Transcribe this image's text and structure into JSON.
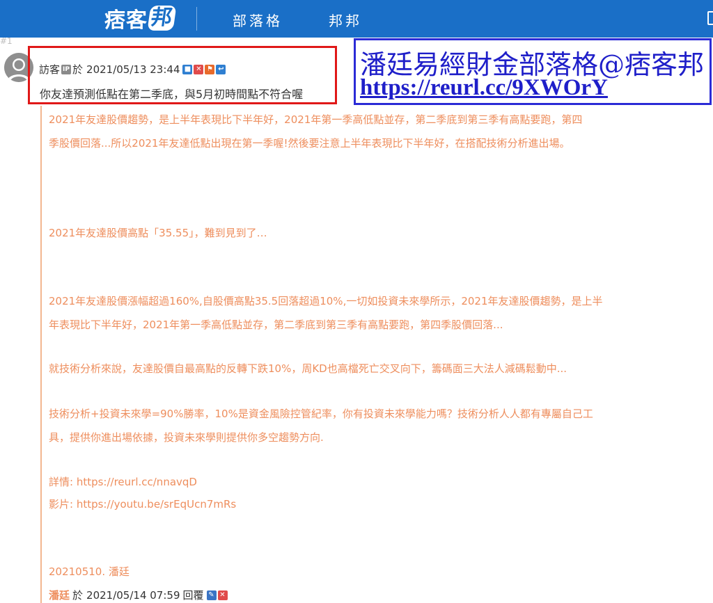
{
  "header": {
    "logo_text": "痞客",
    "logo_text_last": "邦",
    "nav_items": [
      "部落格",
      "邦邦"
    ]
  },
  "post": {
    "number": "#1",
    "comment": {
      "author": "訪客",
      "ip_badge": "IP",
      "on_word": "於",
      "datetime": "2021/05/13 23:44",
      "text": "你友達預測低點在第二季底，與5月初時間點不符合喔"
    },
    "watermark": {
      "title": "潘廷易經財金部落格@痞客邦",
      "url": "https://reurl.cc/9XWOrY"
    },
    "reply": {
      "lines": [
        "2021年友達股價趨勢，是上半年表現比下半年好，2021年第一季高低點並存，第二季底到第三季有高點要跑，第四",
        "季股價回落...所以2021年友達低點出現在第一季喔!然後要注意上半年表現比下半年好，在搭配技術分析進出場。",
        "2021年友達股價高點「35.55」，難到見到了…",
        "2021年友達股價漲幅超過160%,自股價高點35.5回落超過10%,一切如投資未來學所示，2021年友達股價趨勢，是上半",
        "年表現比下半年好，2021年第一季高低點並存，第二季底到第三季有高點要跑，第四季股價回落...",
        "就技術分析來說，友達股價自最高點的反轉下跌10%，周KD也高檔死亡交叉向下，籌碼面三大法人減碼鬆動中...",
        "技術分析+投資未來學=90%勝率，10%是資金風險控管紀率，你有投資未來學能力嗎？技術分析人人都有專屬自己工",
        "具，提供你進出場依據，投資未來學則提供你多空趨勢方向.",
        "詳情: https://reurl.cc/nnavqD",
        "影片: https://youtu.be/srEqUcn7mRs",
        "20210510. 潘廷"
      ],
      "author": "潘廷",
      "on_word": "於",
      "datetime": "2021/05/14 07:59",
      "reply_label": "回覆"
    }
  },
  "colors": {
    "header_bg": "#1a6fc7",
    "reply_text": "#ee8e5d",
    "highlight_border": "#e01818",
    "watermark_border": "#2b2bd6"
  }
}
